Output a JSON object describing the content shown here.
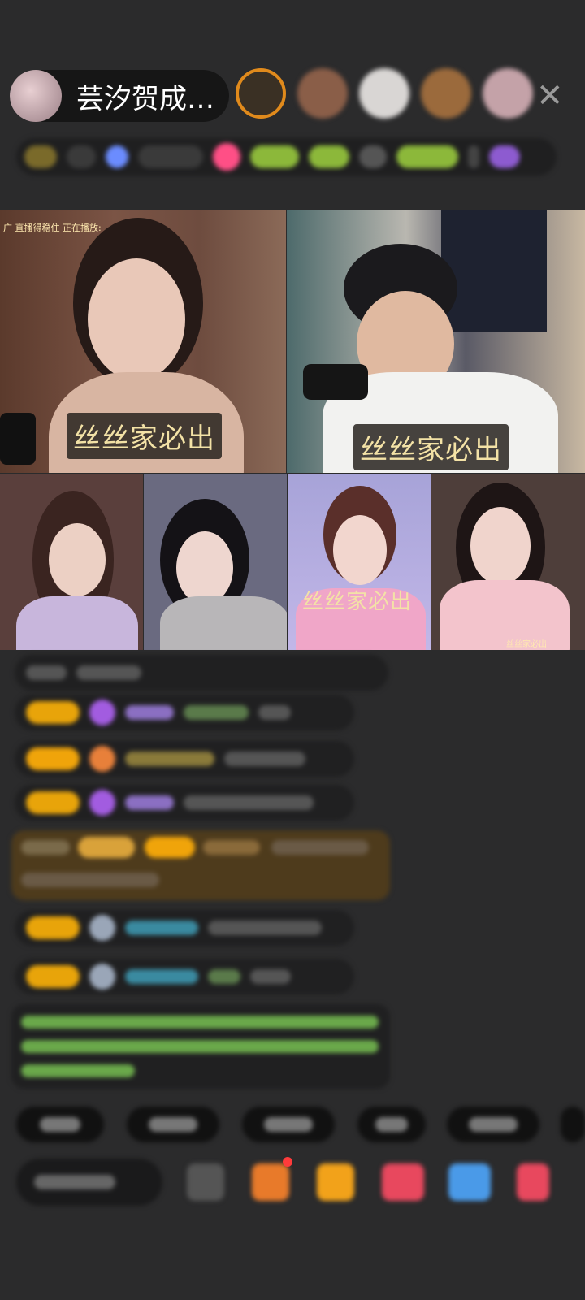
{
  "header": {
    "host_name": "芸汐贺成…",
    "close_glyph": "✕"
  },
  "stream": {
    "tl_corner": "广 直播得稳住  正在播放:",
    "captions": [
      "丝丝家必出",
      "丝丝家必出",
      "丝丝家必出",
      "丝丝家必出"
    ]
  },
  "colors": {
    "background": "#2b2b2c",
    "badge": "#e8a40a",
    "caption_text": "#f3e2a6",
    "chat_green": "#7fd34a"
  },
  "icons": [
    "close-icon",
    "gift-icon",
    "game-icon",
    "chat-icon",
    "share-icon",
    "more-icon"
  ]
}
